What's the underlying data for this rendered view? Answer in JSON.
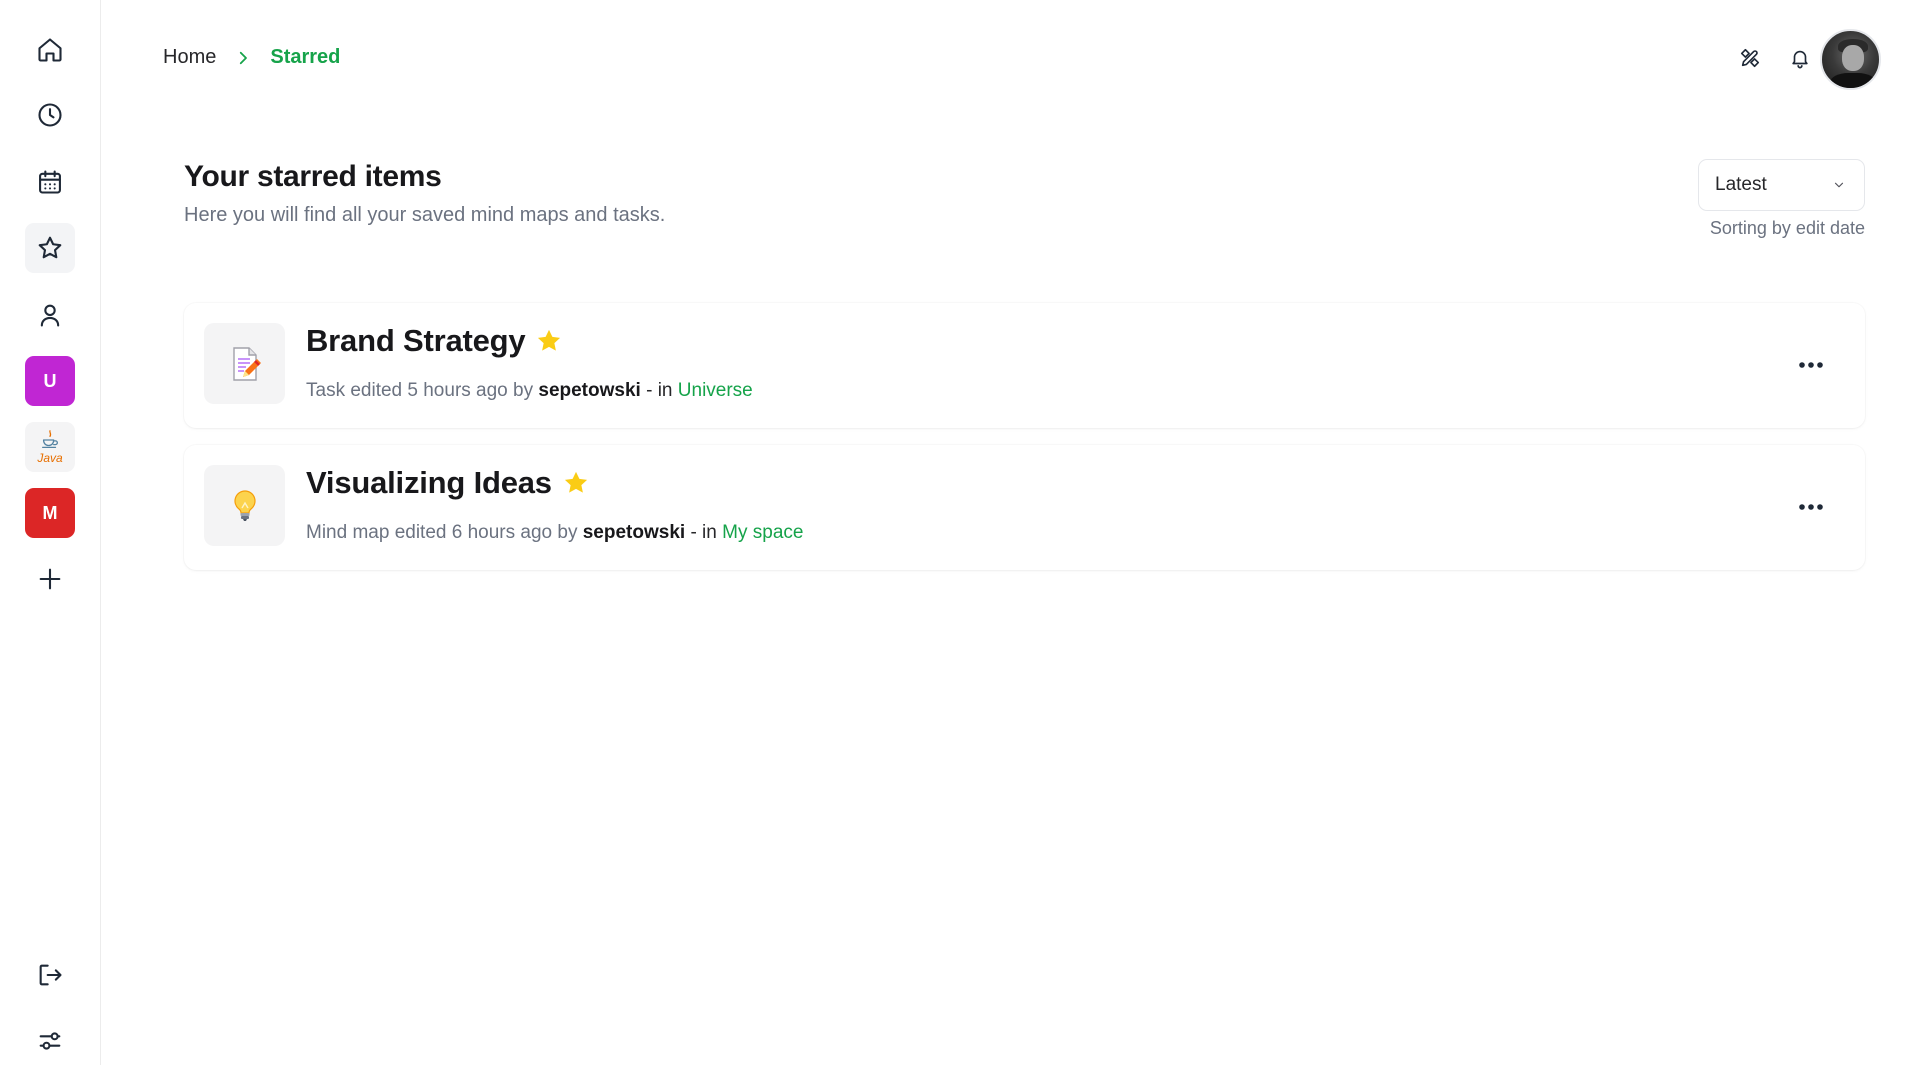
{
  "sidebar": {
    "workspaces": [
      {
        "label": "U",
        "color": "#c026d3"
      },
      {
        "label": "Java",
        "color": "#e76f00"
      },
      {
        "label": "M",
        "color": "#dc2626"
      }
    ]
  },
  "breadcrumb": {
    "home": "Home",
    "current": "Starred"
  },
  "header": {
    "title": "Your starred items",
    "subtitle": "Here you will find all your saved mind maps and tasks."
  },
  "sort": {
    "value": "Latest",
    "caption": "Sorting by edit date"
  },
  "items": [
    {
      "title": "Brand Strategy",
      "meta_prefix": "Task edited 5 hours ago by",
      "author": "sepetowski",
      "meta_sep": "- in",
      "space": "Universe",
      "icon": "document-pencil-icon"
    },
    {
      "title": "Visualizing Ideas",
      "meta_prefix": "Mind map edited 6 hours ago by",
      "author": "sepetowski",
      "meta_sep": "- in",
      "space": "My space",
      "icon": "lightbulb-icon"
    }
  ],
  "colors": {
    "accent": "#16a34a",
    "star": "#facc15"
  }
}
